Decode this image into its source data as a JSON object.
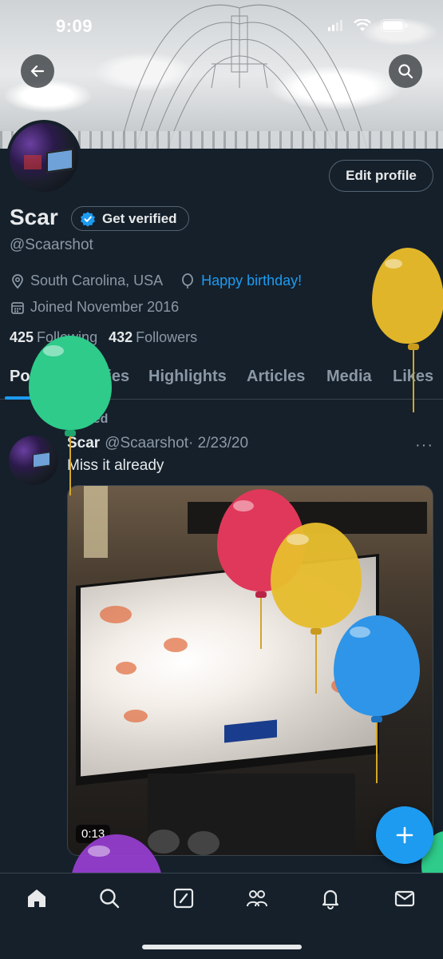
{
  "status_bar": {
    "time": "9:09"
  },
  "header": {
    "back_icon": "arrow-left-icon",
    "search_icon": "search-icon"
  },
  "profile": {
    "name": "Scar",
    "get_verified_label": "Get verified",
    "handle": "@Scaarshot",
    "edit_profile_label": "Edit profile",
    "location": "South Carolina, USA",
    "birthday_text": "Happy birthday!",
    "joined": "Joined November 2016",
    "following_count": "425",
    "following_label": "Following",
    "followers_count": "432",
    "followers_label": "Followers"
  },
  "tabs": [
    {
      "label": "Posts",
      "active": true
    },
    {
      "label": "Replies",
      "active": false
    },
    {
      "label": "Highlights",
      "active": false
    },
    {
      "label": "Articles",
      "active": false
    },
    {
      "label": "Media",
      "active": false
    },
    {
      "label": "Likes",
      "active": false
    }
  ],
  "post": {
    "pinned_label": "Pinned",
    "author_name": "Scar",
    "author_handle": "@Scaarshot",
    "date": "· 2/23/20",
    "text": "Miss it already",
    "video_duration": "0:13"
  },
  "bottom_nav": [
    "home-icon",
    "search-icon",
    "compose-icon",
    "communities-icon",
    "notifications-icon",
    "messages-icon"
  ],
  "colors": {
    "background": "#15202b",
    "accent": "#1d9bf0",
    "text_primary": "#e7e9ea",
    "text_secondary": "#8b98a5",
    "border": "#38444d"
  }
}
